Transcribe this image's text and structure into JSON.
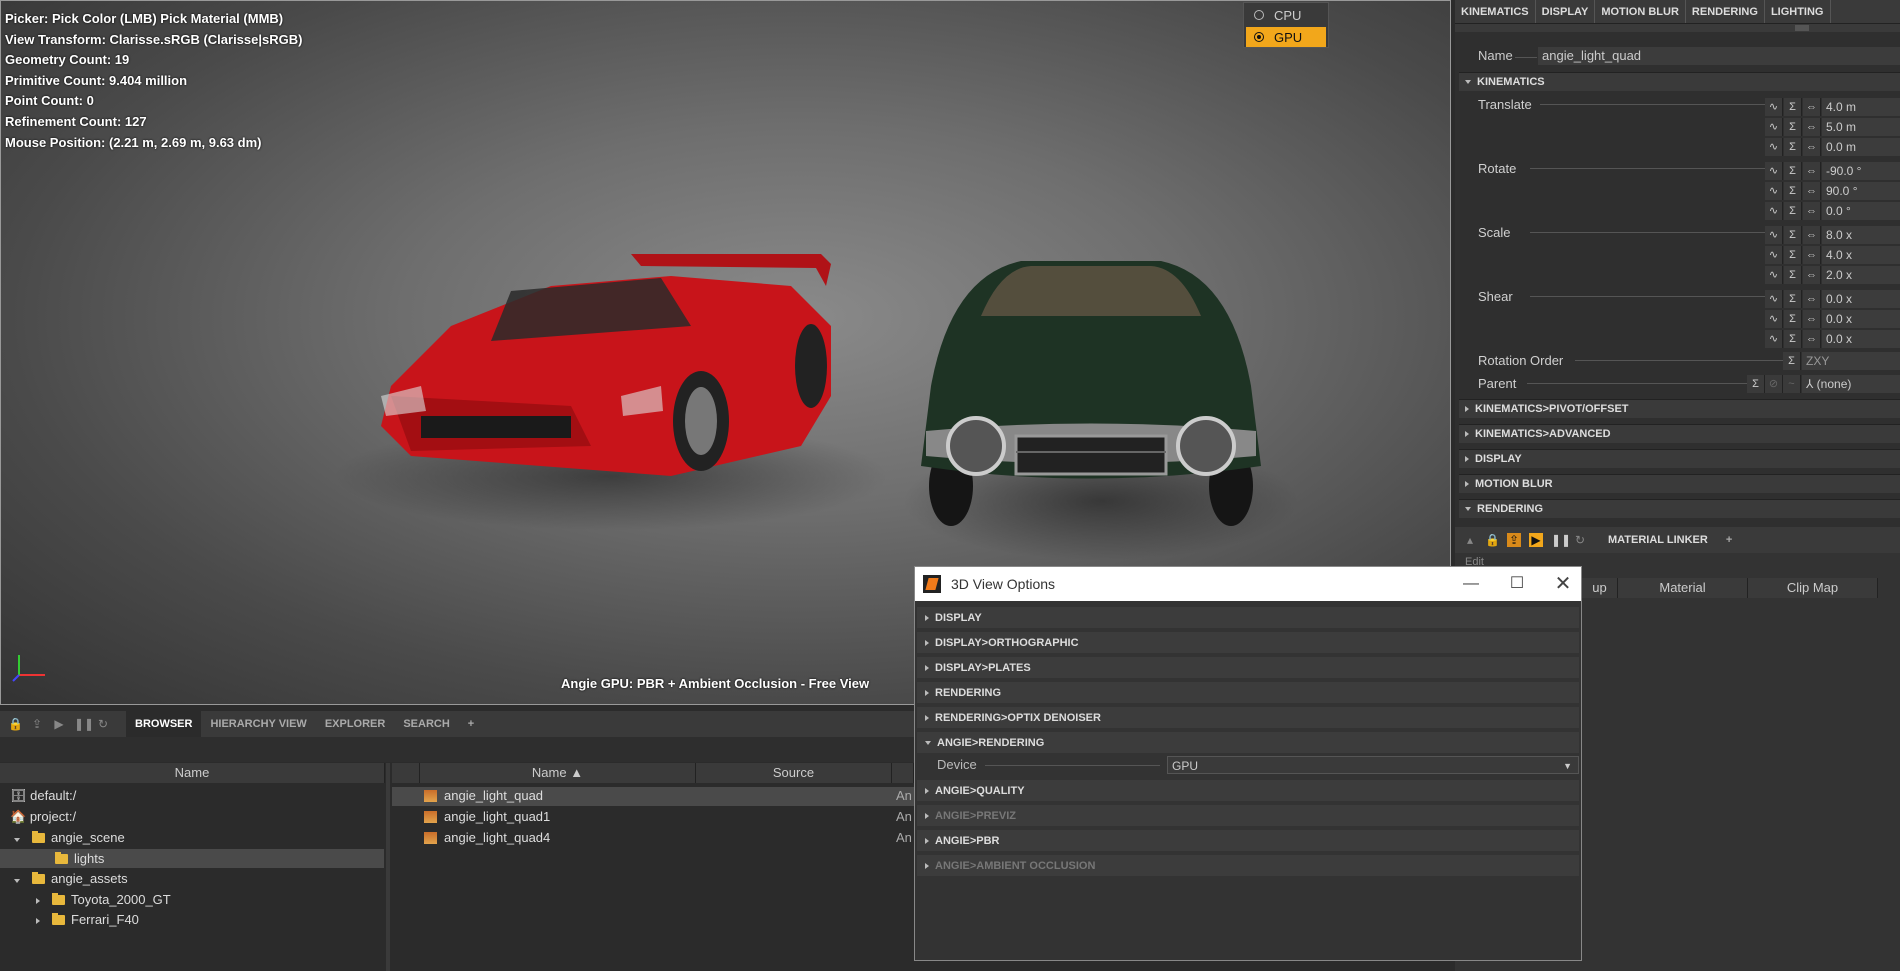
{
  "viewport": {
    "hud": [
      "Picker: Pick Color (LMB)  Pick Material (MMB)",
      "View Transform: Clarisse.sRGB (Clarisse|sRGB)",
      "Geometry Count: 19",
      "Primitive Count: 9.404 million",
      "Point Count: 0",
      "Refinement Count: 127",
      "Mouse Position:  (2.21 m, 2.69 m, 9.63 dm)"
    ],
    "caption": "Angie GPU: PBR + Ambient Occlusion - Free View"
  },
  "device_popup": {
    "options": [
      "CPU",
      "GPU"
    ],
    "selected": "GPU"
  },
  "attribute_editor": {
    "tabs": [
      "KINEMATICS",
      "DISPLAY",
      "MOTION BLUR",
      "RENDERING",
      "LIGHTING"
    ],
    "name_label": "Name",
    "name_value": "angie_light_quad",
    "section_kinematics": "KINEMATICS",
    "translate_label": "Translate",
    "translate": [
      "4.0 m",
      "5.0 m",
      "0.0 m"
    ],
    "rotate_label": "Rotate",
    "rotate": [
      "-90.0 °",
      "90.0 °",
      "0.0 °"
    ],
    "scale_label": "Scale",
    "scale": [
      "8.0 x",
      "4.0 x",
      "2.0 x"
    ],
    "shear_label": "Shear",
    "shear": [
      "0.0 x",
      "0.0 x",
      "0.0 x"
    ],
    "rotation_order_label": "Rotation Order",
    "rotation_order": "ZXY",
    "parent_label": "Parent",
    "parent": "(none)",
    "sections": [
      "KINEMATICS>PIVOT/OFFSET",
      "KINEMATICS>ADVANCED",
      "DISPLAY",
      "MOTION BLUR",
      "RENDERING"
    ]
  },
  "material_linker": {
    "tab": "MATERIAL LINKER",
    "edit": "Edit",
    "columns": [
      "up",
      "Material",
      "Clip Map"
    ]
  },
  "browser": {
    "tabs": [
      "BROWSER",
      "HIERARCHY VIEW",
      "EXPLORER",
      "SEARCH"
    ],
    "add": "+",
    "tree_header": "Name",
    "tree": [
      {
        "label": "default:/",
        "level": 0
      },
      {
        "label": "project:/",
        "level": 0
      },
      {
        "label": "angie_scene",
        "level": 1
      },
      {
        "label": "lights",
        "level": 2
      },
      {
        "label": "angie_assets",
        "level": 1
      },
      {
        "label": "Toyota_2000_GT",
        "level": 2
      },
      {
        "label": "Ferrari_F40",
        "level": 2
      }
    ],
    "list_headers": [
      "Name ▲",
      "Source"
    ],
    "items": [
      {
        "name": "angie_light_quad",
        "type": "An"
      },
      {
        "name": "angie_light_quad1",
        "type": "An"
      },
      {
        "name": "angie_light_quad4",
        "type": "An"
      }
    ]
  },
  "dialog": {
    "title": "3D View Options",
    "sections": [
      {
        "label": "DISPLAY",
        "dim": false
      },
      {
        "label": "DISPLAY>ORTHOGRAPHIC",
        "dim": false
      },
      {
        "label": "DISPLAY>PLATES",
        "dim": false
      },
      {
        "label": "RENDERING",
        "dim": false
      },
      {
        "label": "RENDERING>OPTIX DENOISER",
        "dim": false
      },
      {
        "label": "ANGIE>RENDERING",
        "dim": false,
        "open": true
      }
    ],
    "device_label": "Device",
    "device_value": "GPU",
    "sections_after": [
      {
        "label": "ANGIE>QUALITY",
        "dim": false
      },
      {
        "label": "ANGIE>PREVIZ",
        "dim": true
      },
      {
        "label": "ANGIE>PBR",
        "dim": false
      },
      {
        "label": "ANGIE>AMBIENT OCCLUSION",
        "dim": true
      }
    ]
  },
  "colors": {
    "accent": "#f2a71b",
    "panel": "#2f2f2f",
    "ferrari_red": "#c8141a",
    "toyota_green": "#1e3324"
  }
}
